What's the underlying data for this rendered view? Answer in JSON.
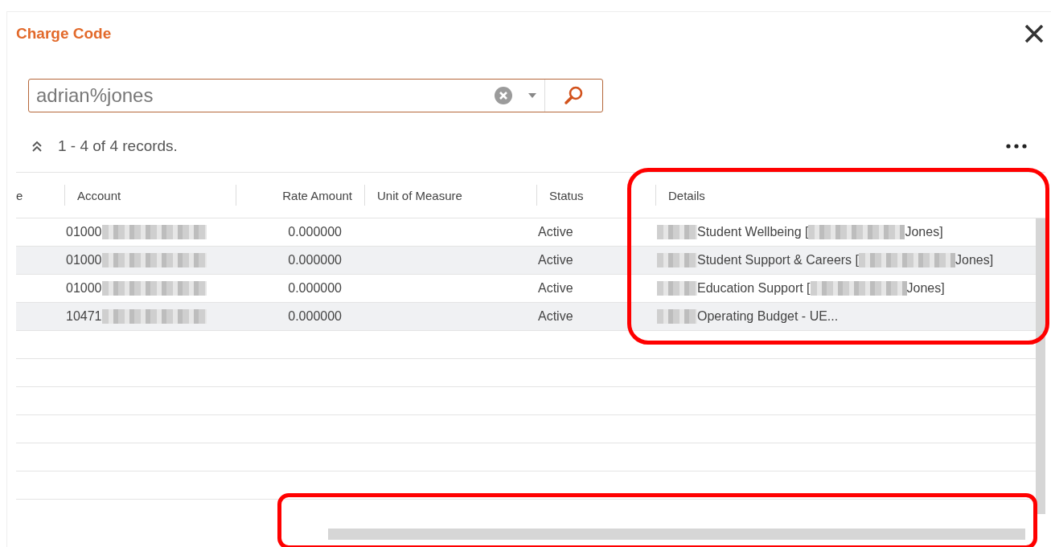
{
  "dialog": {
    "title": "Charge Code"
  },
  "search": {
    "value": "adrian%jones"
  },
  "summary": "1 - 4 of 4 records.",
  "table": {
    "columns": [
      {
        "label": "e"
      },
      {
        "label": "Account"
      },
      {
        "label": "Rate Amount"
      },
      {
        "label": "Unit of Measure"
      },
      {
        "label": "Status"
      },
      {
        "label": "Details"
      }
    ],
    "rows": [
      {
        "cells": [
          [],
          [
            {
              "kind": "text",
              "text": "01000"
            },
            {
              "kind": "redacted"
            }
          ],
          [
            {
              "kind": "text",
              "text": "0.000000"
            }
          ],
          [],
          [
            {
              "kind": "text",
              "text": "Active"
            }
          ],
          [
            {
              "kind": "redacted"
            },
            {
              "kind": "text",
              "text": "Student Wellbeing ["
            },
            {
              "kind": "redacted"
            },
            {
              "kind": "text",
              "text": "Jones]"
            }
          ]
        ]
      },
      {
        "cells": [
          [],
          [
            {
              "kind": "text",
              "text": "01000"
            },
            {
              "kind": "redacted"
            }
          ],
          [
            {
              "kind": "text",
              "text": "0.000000"
            }
          ],
          [],
          [
            {
              "kind": "text",
              "text": "Active"
            }
          ],
          [
            {
              "kind": "redacted"
            },
            {
              "kind": "text",
              "text": "Student Support & Careers ["
            },
            {
              "kind": "redacted"
            },
            {
              "kind": "text",
              "text": "Jones]"
            }
          ]
        ]
      },
      {
        "cells": [
          [],
          [
            {
              "kind": "text",
              "text": "01000"
            },
            {
              "kind": "redacted"
            }
          ],
          [
            {
              "kind": "text",
              "text": "0.000000"
            }
          ],
          [],
          [
            {
              "kind": "text",
              "text": "Active"
            }
          ],
          [
            {
              "kind": "redacted"
            },
            {
              "kind": "text",
              "text": "Education Support ["
            },
            {
              "kind": "redacted"
            },
            {
              "kind": "text",
              "text": "Jones]"
            }
          ]
        ]
      },
      {
        "cells": [
          [],
          [
            {
              "kind": "text",
              "text": "10471"
            },
            {
              "kind": "redacted"
            }
          ],
          [
            {
              "kind": "text",
              "text": "0.000000"
            }
          ],
          [],
          [
            {
              "kind": "text",
              "text": "Active"
            }
          ],
          [
            {
              "kind": "redacted"
            },
            {
              "kind": "text",
              "text": "Operating Budget - UE..."
            }
          ]
        ]
      }
    ]
  },
  "highlights": {
    "details_column": true,
    "horizontal_scrollbar": true
  }
}
